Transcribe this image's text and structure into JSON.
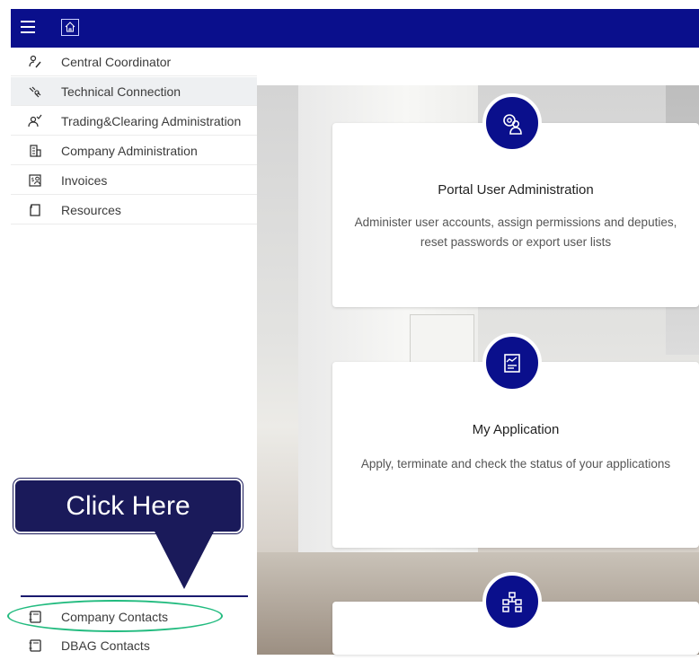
{
  "topbar": {
    "menu_icon": "hamburger-icon",
    "home_icon": "home-icon",
    "color": "#0a0f8c"
  },
  "sidebar": {
    "items": [
      {
        "label": "Central Coordinator",
        "icon": "person-pen-icon"
      },
      {
        "label": "Technical Connection",
        "icon": "connection-icon"
      },
      {
        "label": "Trading&Clearing Administration",
        "icon": "person-check-icon"
      },
      {
        "label": "Company Administration",
        "icon": "building-icon"
      },
      {
        "label": "Invoices",
        "icon": "invoice-icon"
      },
      {
        "label": "Resources",
        "icon": "document-icon"
      }
    ],
    "bottom_items": [
      {
        "label": "Company Contacts",
        "icon": "contact-book-icon"
      },
      {
        "label": "DBAG Contacts",
        "icon": "contact-book-icon"
      }
    ]
  },
  "cards": [
    {
      "title": "Portal User Administration",
      "description": "Administer user accounts, assign permissions and deputies, reset passwords or export user lists",
      "icon": "user-settings-icon"
    },
    {
      "title": "My Application",
      "description": "Apply, terminate and check the status of your applications",
      "icon": "application-form-icon"
    },
    {
      "title": "",
      "description": "",
      "icon": "network-icon"
    }
  ],
  "callout": {
    "text": "Click Here",
    "color": "#1a1a5a"
  },
  "highlight_color": "#22bb7f"
}
